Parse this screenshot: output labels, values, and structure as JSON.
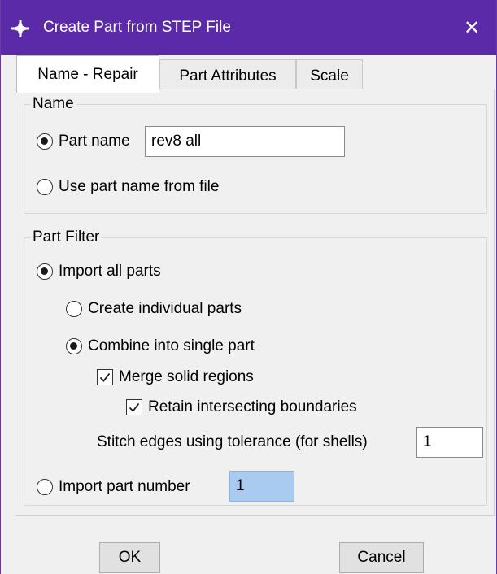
{
  "window": {
    "title": "Create Part from STEP File",
    "close_glyph": "✕",
    "title_icon": "abaqus-plus-icon",
    "title_bar_color": "#5b2aa8"
  },
  "tabs": [
    {
      "label": "Name - Repair",
      "active": true
    },
    {
      "label": "Part Attributes",
      "active": false
    },
    {
      "label": "Scale",
      "active": false
    }
  ],
  "name_group": {
    "legend": "Name",
    "part_name_label": "Part name",
    "part_name_value": "rev8 all",
    "use_file_name_label": "Use part name from file"
  },
  "filter_group": {
    "legend": "Part Filter",
    "import_all_label": "Import all parts",
    "create_individual_label": "Create individual parts",
    "combine_label": "Combine into single part",
    "merge_label": "Merge solid regions",
    "retain_label": "Retain intersecting boundaries",
    "stitch_label": "Stitch edges using tolerance (for shells)",
    "stitch_value": "1",
    "import_number_label": "Import part number",
    "import_number_value": "1"
  },
  "buttons": {
    "ok": "OK",
    "cancel": "Cancel"
  }
}
